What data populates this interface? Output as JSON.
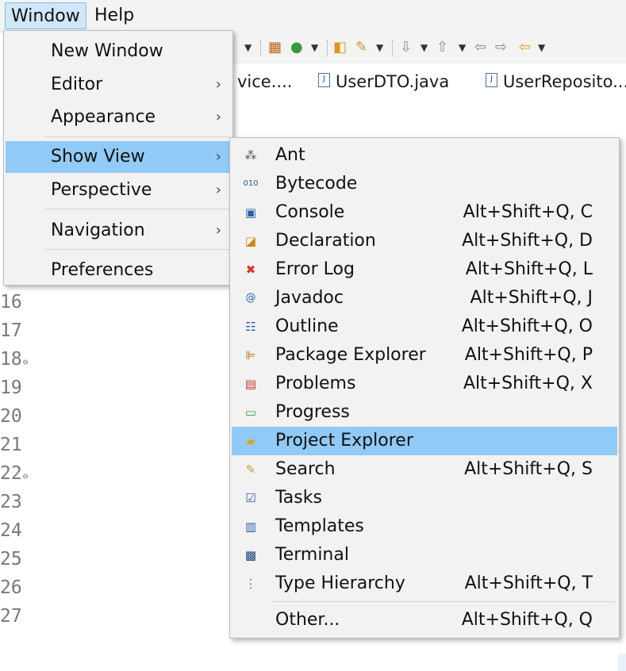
{
  "menubar": {
    "window": "Window",
    "help": "Help"
  },
  "editor_tabs": [
    {
      "label": "vice....",
      "icon": "none"
    },
    {
      "label": "UserDTO.java",
      "icon": "java-file-icon"
    },
    {
      "label": "UserReposito...",
      "icon": "java-file-icon"
    }
  ],
  "line_numbers": [
    "16",
    "17",
    "18",
    "19",
    "20",
    "21",
    "22",
    "23",
    "24",
    "25",
    "26",
    "27"
  ],
  "fold_markers": {
    "18": "⊖",
    "22": "⊖"
  },
  "window_menu": {
    "new_window": "New Window",
    "editor": "Editor",
    "appearance": "Appearance",
    "show_view": "Show View",
    "perspective": "Perspective",
    "navigation": "Navigation",
    "preferences": "Preferences",
    "arrow": "›"
  },
  "show_view_menu": {
    "items": [
      {
        "label": "Ant",
        "shortcut": "",
        "icon": "ant-icon"
      },
      {
        "label": "Bytecode",
        "shortcut": "",
        "icon": "bytecode-icon"
      },
      {
        "label": "Console",
        "shortcut": "Alt+Shift+Q, C",
        "icon": "console-icon"
      },
      {
        "label": "Declaration",
        "shortcut": "Alt+Shift+Q, D",
        "icon": "declaration-icon"
      },
      {
        "label": "Error Log",
        "shortcut": "Alt+Shift+Q, L",
        "icon": "error-log-icon"
      },
      {
        "label": "Javadoc",
        "shortcut": "Alt+Shift+Q, J",
        "icon": "javadoc-icon"
      },
      {
        "label": "Outline",
        "shortcut": "Alt+Shift+Q, O",
        "icon": "outline-icon"
      },
      {
        "label": "Package Explorer",
        "shortcut": "Alt+Shift+Q, P",
        "icon": "package-explorer-icon"
      },
      {
        "label": "Problems",
        "shortcut": "Alt+Shift+Q, X",
        "icon": "problems-icon"
      },
      {
        "label": "Progress",
        "shortcut": "",
        "icon": "progress-icon"
      },
      {
        "label": "Project Explorer",
        "shortcut": "",
        "icon": "project-explorer-icon"
      },
      {
        "label": "Search",
        "shortcut": "Alt+Shift+Q, S",
        "icon": "search-icon"
      },
      {
        "label": "Tasks",
        "shortcut": "",
        "icon": "tasks-icon"
      },
      {
        "label": "Templates",
        "shortcut": "",
        "icon": "templates-icon"
      },
      {
        "label": "Terminal",
        "shortcut": "",
        "icon": "terminal-icon"
      },
      {
        "label": "Type Hierarchy",
        "shortcut": "Alt+Shift+Q, T",
        "icon": "type-hierarchy-icon"
      }
    ],
    "other": {
      "label": "Other...",
      "shortcut": "Alt+Shift+Q, Q"
    }
  },
  "colors": {
    "selection": "#91c9f7",
    "menu_background": "#f2f2f2",
    "menubar_active": "#cfe6fb"
  }
}
